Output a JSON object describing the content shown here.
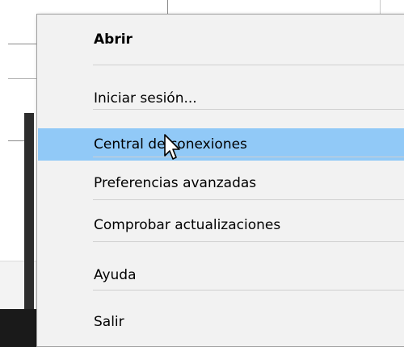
{
  "context_menu": {
    "items": [
      {
        "label": "Abrir",
        "default": true
      },
      {
        "label": "Iniciar sesión..."
      },
      {
        "label": "Central de conexiones",
        "hovered": true
      },
      {
        "label": "Preferencias avanzadas"
      },
      {
        "label": "Comprobar actualizaciones"
      },
      {
        "label": "Ayuda"
      },
      {
        "label": "Salir"
      }
    ]
  },
  "colors": {
    "menu_background": "#f2f2f2",
    "hover_highlight": "#91c9f7",
    "taskbar": "#1a1a1a"
  },
  "icons": {
    "cursor": "arrow-pointer-icon"
  }
}
